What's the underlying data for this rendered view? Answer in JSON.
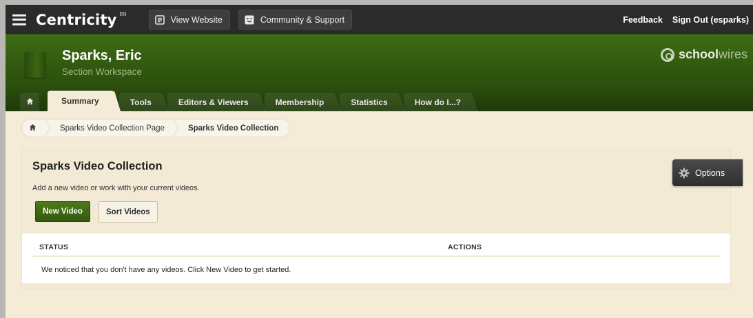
{
  "topbar": {
    "brand": "Centricity",
    "brand_mark": "tm",
    "menu_icon": "hamburger-icon",
    "view_website": {
      "label": "View Website",
      "icon": "document-icon"
    },
    "community": {
      "label": "Community & Support",
      "icon": "smiley-icon"
    },
    "feedback": "Feedback",
    "sign_out": "Sign Out (esparks)"
  },
  "header": {
    "workspace_name": "Sparks, Eric",
    "workspace_type": "Section Workspace",
    "logo": {
      "bold": "school",
      "light": "wires"
    },
    "accent_color": "#325a0f"
  },
  "tabs": [
    {
      "label": "Summary",
      "active": true
    },
    {
      "label": "Tools"
    },
    {
      "label": "Editors & Viewers"
    },
    {
      "label": "Membership"
    },
    {
      "label": "Statistics"
    },
    {
      "label": "How do I...?"
    }
  ],
  "breadcrumb": {
    "home_icon": "home-icon",
    "items": [
      "Sparks Video Collection Page",
      "Sparks Video Collection"
    ]
  },
  "panel": {
    "title": "Sparks Video Collection",
    "description": "Add a new video or work with your current videos.",
    "new_video_label": "New Video",
    "sort_videos_label": "Sort Videos",
    "options_label": "Options"
  },
  "table": {
    "columns": [
      "STATUS",
      "ACTIONS"
    ],
    "empty_message": "We noticed that you don't have any videos. Click New Video to get started."
  }
}
